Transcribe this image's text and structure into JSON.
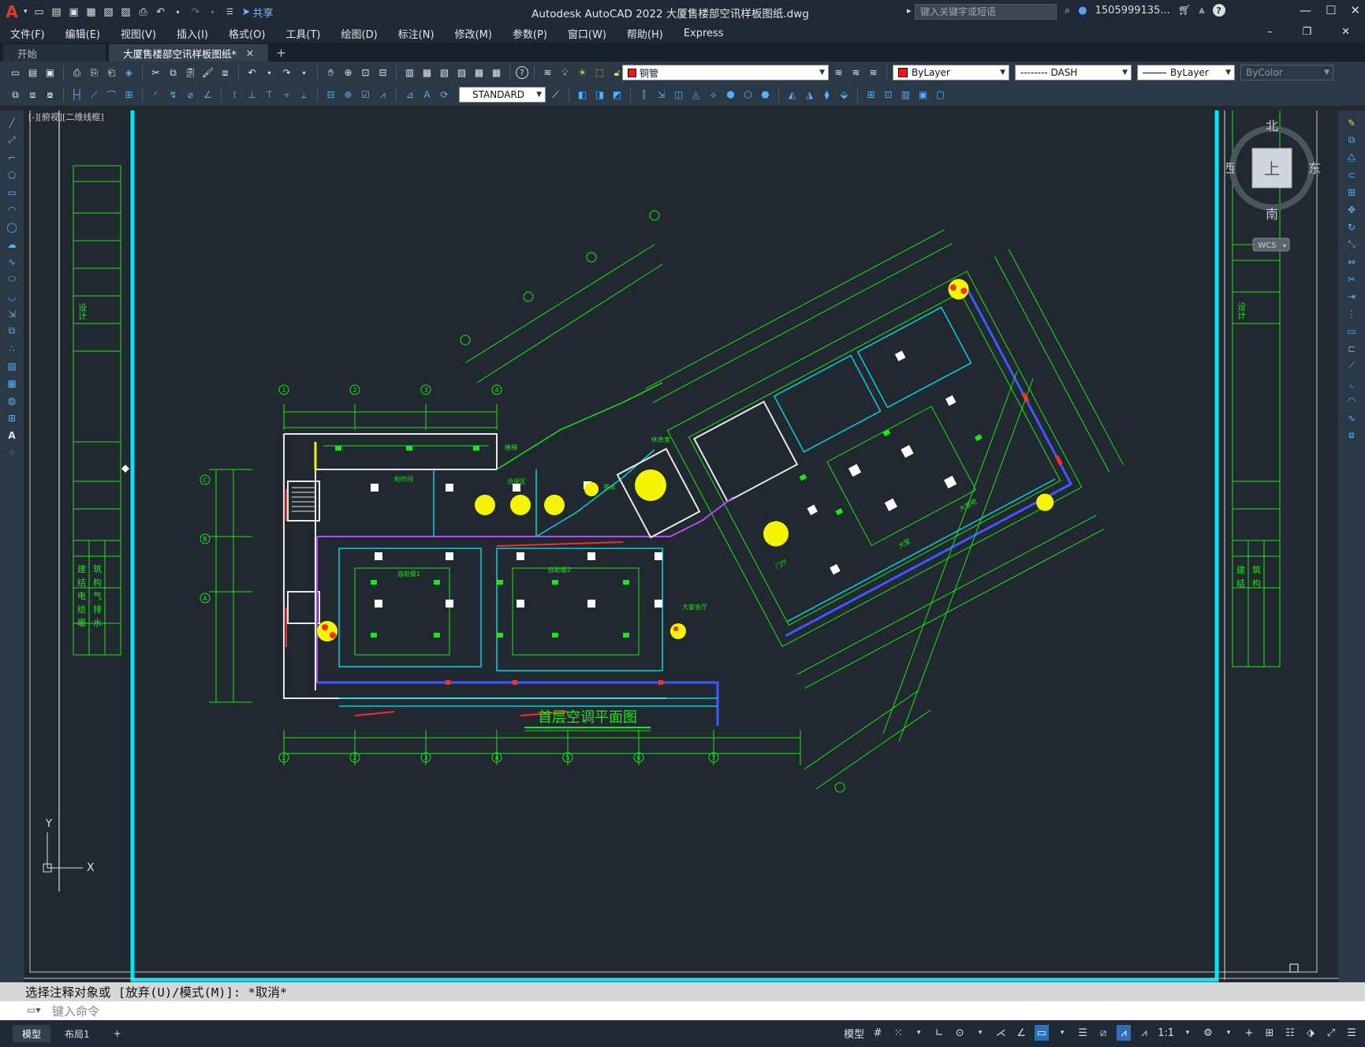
{
  "app": {
    "window_title": "Autodesk AutoCAD 2022    大厦售楼部空讯样板图纸.dwg",
    "share_label": "共享",
    "search_placeholder": "键入关键字或短语",
    "user_name": "1505999135...",
    "help_label": "?"
  },
  "menu": [
    "文件(F)",
    "编辑(E)",
    "视图(V)",
    "插入(I)",
    "格式(O)",
    "工具(T)",
    "绘图(D)",
    "标注(N)",
    "修改(M)",
    "参数(P)",
    "窗口(W)",
    "帮助(H)",
    "Express"
  ],
  "doc_tabs": [
    {
      "label": "开始",
      "active": false
    },
    {
      "label": "大厦售楼部空讯样板图纸*",
      "active": true
    }
  ],
  "toolbar": {
    "layer_name": "铜管",
    "color": "ByLayer",
    "linetype": "-------- DASH",
    "lineweight": "ByLayer",
    "plotstyle": "ByColor",
    "text_style": "STANDARD"
  },
  "viewport_label": "[-][俯视][二维线框]",
  "viewcube": {
    "north": "北",
    "south": "南",
    "east": "东",
    "west": "西",
    "top": "上",
    "wcs": "WCS"
  },
  "drawing": {
    "title": "首层空调平面图",
    "ucs_x": "X",
    "ucs_y": "Y",
    "room_labels": [
      "自助餐1",
      "自助餐2",
      "大宴会厅",
      "大堂",
      "制作间",
      "洽谈区",
      "门厅",
      "休息室",
      "茶水",
      "楼梯",
      "大堂吧"
    ],
    "grid_bottom": [
      "1",
      "2",
      "3",
      "4",
      "5",
      "6",
      "7"
    ],
    "grid_top": [
      "1",
      "2",
      "3",
      "4"
    ],
    "grid_left": [
      "C",
      "B",
      "A"
    ],
    "titleblock_left_a": "设计",
    "titleblock_left_b": [
      "建",
      "结",
      "电",
      "给",
      "暖"
    ],
    "titleblock_left_c": [
      "筑",
      "构",
      "气",
      "排",
      "水"
    ],
    "titleblock_right_a": "设计",
    "titleblock_right_b": [
      "建",
      "结"
    ],
    "titleblock_right_c": [
      "筑",
      "构"
    ]
  },
  "command": {
    "history": "选择注释对象或 [放弃(U)/模式(M)]: *取消*",
    "placeholder": "键入命令"
  },
  "status": {
    "layout_tabs": [
      {
        "label": "模型",
        "active": true
      },
      {
        "label": "布局1",
        "active": false
      }
    ],
    "model_label": "模型",
    "scale": "1:1"
  },
  "colors": {
    "background": "#212830",
    "frame": "#00e5ff",
    "green": "#17e817",
    "blue": "#3a5bff",
    "magenta": "#b14bff",
    "yellow": "#f5f500",
    "red": "#ff2a2a"
  }
}
